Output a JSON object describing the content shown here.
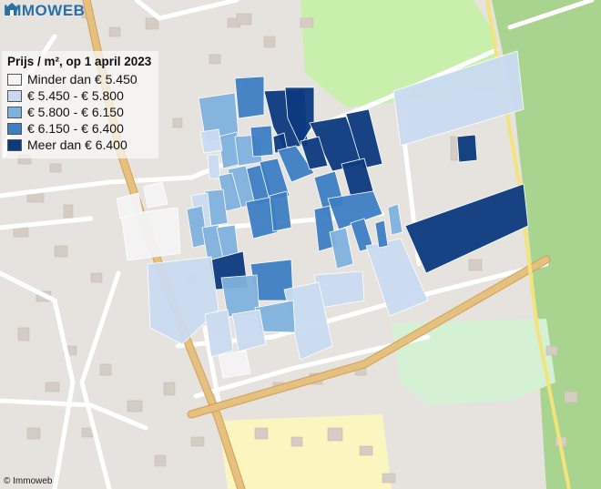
{
  "brand": {
    "name": "IMMOWEB",
    "color": "#2a6ea8"
  },
  "legend": {
    "title": "Prijs / m², op 1 april 2023",
    "classes": [
      {
        "label": "Minder dan € 5.450",
        "color": "#f3f3f4"
      },
      {
        "label": "€ 5.450 - € 5.800",
        "color": "#c9daf0"
      },
      {
        "label": "€ 5.800 - € 6.150",
        "color": "#7fb1dd"
      },
      {
        "label": "€ 6.150 - € 6.400",
        "color": "#3d7ec4"
      },
      {
        "label": "Meer dan € 6.400",
        "color": "#0c3a80"
      }
    ]
  },
  "copyright": "© Immoweb",
  "map_colors": {
    "background": "#e6e3de",
    "green_open": "#c9efad",
    "forest": "#a9d48f",
    "park": "#d4f1d4",
    "yellow_area": "#fbf6c0",
    "main_road": "#e6c07f",
    "minor_road": "#ffffff",
    "building": "#d5cdc3"
  }
}
